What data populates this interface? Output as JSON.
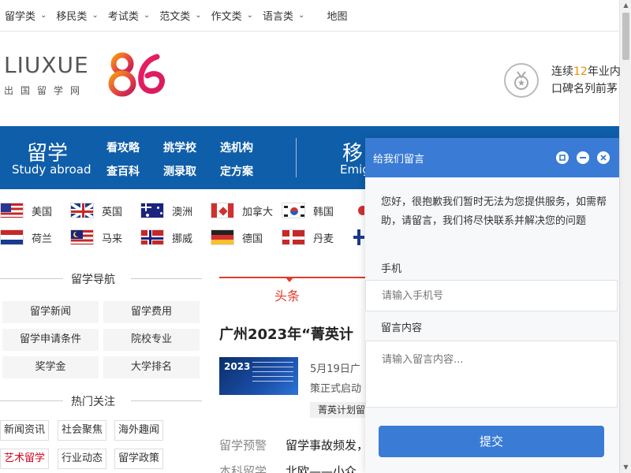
{
  "topnav": {
    "items": [
      {
        "label": "留学类",
        "chevron": "⌄"
      },
      {
        "label": "移民类",
        "chevron": "⌄"
      },
      {
        "label": "考试类",
        "chevron": "⌄"
      },
      {
        "label": "范文类",
        "chevron": "⌄"
      },
      {
        "label": "作文类",
        "chevron": "⌄"
      },
      {
        "label": "语言类",
        "chevron": "⌄"
      }
    ],
    "map": "地图"
  },
  "logo": {
    "word": "LIUXUE",
    "sub": "出国留学网",
    "number": "86"
  },
  "slogan": {
    "pre": "连续",
    "num": "12",
    "post": "年业内",
    "line2": "口碑名列前茅",
    "accent": "#f08c00"
  },
  "band": {
    "liuxue_title": "留学",
    "liuxue_en": "Study abroad",
    "links": [
      "看攻略",
      "挑学校",
      "选机构",
      "查百科",
      "测录取",
      "定方案"
    ],
    "yimin_title": "移",
    "yimin_en": "Emig",
    "color": "#0f5ea9"
  },
  "countries": [
    {
      "name": "美国",
      "flag": "us-flag"
    },
    {
      "name": "英国",
      "flag": "uk-flag"
    },
    {
      "name": "澳洲",
      "flag": "au-flag"
    },
    {
      "name": "加拿大",
      "flag": "ca-flag"
    },
    {
      "name": "韩国",
      "flag": "kr-flag"
    },
    {
      "name": "荷兰",
      "flag": "nl-flag"
    },
    {
      "name": "马来",
      "flag": "my-flag"
    },
    {
      "name": "挪威",
      "flag": "no-flag"
    },
    {
      "name": "德国",
      "flag": "de-flag"
    },
    {
      "name": "丹麦",
      "flag": "dk-flag"
    }
  ],
  "nav": {
    "title": "留学导航",
    "items": [
      "留学新闻",
      "留学费用",
      "留学申请条件",
      "院校专业",
      "奖学金",
      "大学排名"
    ]
  },
  "hot": {
    "title": "热门关注",
    "tags": [
      "新闻资讯",
      "社会聚焦",
      "海外趣闻",
      "艺术留学",
      "行业动态",
      "留学政策"
    ]
  },
  "headline": {
    "tab": "头条",
    "title": "广州2023年“菁英计",
    "thumb_year": "2023",
    "date": "5月19日广",
    "line2": "策正式启动",
    "tag": "菁英计划留"
  },
  "list": [
    {
      "label": "留学预警",
      "text": "留学事故频发，"
    },
    {
      "label": "本科留学",
      "text": "北欧——小众"
    }
  ],
  "chat": {
    "title": "给我们留言",
    "message": "您好，很抱歉我们暂时无法为您提供服务，如需帮助，请留言，我们将尽快联系并解决您的问题",
    "phone_label": "手机",
    "phone_placeholder": "请输入手机号",
    "content_label": "留言内容",
    "content_placeholder": "请输入留言内容...",
    "submit": "提交",
    "accent": "#3a7bd5"
  }
}
